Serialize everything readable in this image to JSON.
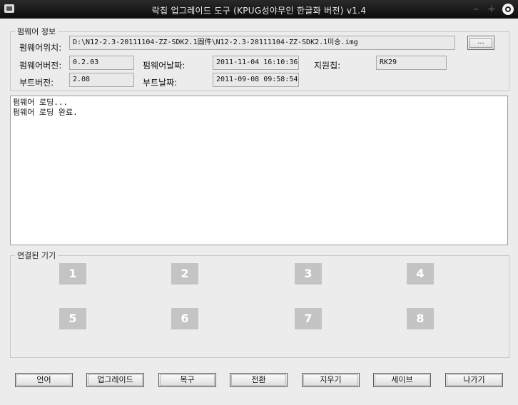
{
  "window": {
    "title": "락칩 업그레이드 도구 (KPUG성야무인 한글화 버전) v1.4",
    "minimize": "–",
    "maximize": "+"
  },
  "firmware_info": {
    "legend": "펌웨어 정보",
    "location_label": "펌웨어위치:",
    "location_value": "D:\\N12-2.3-20111104-ZZ-SDK2.1固件\\N12-2.3-20111104-ZZ-SDK2.1미송.img",
    "browse_label": "...",
    "version_label": "펌웨어버전:",
    "version_value": "0.2.03",
    "fw_date_label": "펌웨어날짜:",
    "fw_date_value": "2011-11-04 16:10:36",
    "chip_label": "지원칩:",
    "chip_value": "RK29",
    "boot_version_label": "부트버전:",
    "boot_version_value": "2.08",
    "boot_date_label": "부트날짜:",
    "boot_date_value": "2011-09-08 09:58:54"
  },
  "log": {
    "lines": [
      "펌웨어 로딩...",
      "펌웨어 로딩 완료."
    ]
  },
  "devices": {
    "legend": "연결된 기기",
    "slots": [
      "1",
      "2",
      "3",
      "4",
      "5",
      "6",
      "7",
      "8"
    ]
  },
  "buttons": {
    "language": "언어",
    "upgrade": "업그레이드",
    "restore": "복구",
    "switch": "전환",
    "erase": "지우기",
    "save": "세이브",
    "exit": "나가기"
  }
}
